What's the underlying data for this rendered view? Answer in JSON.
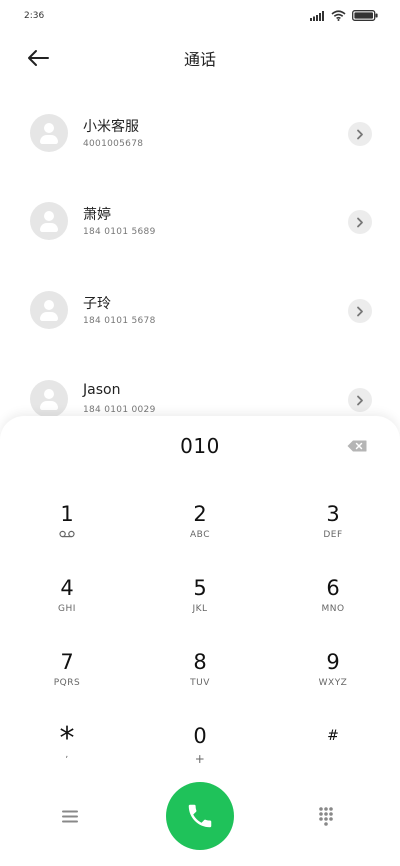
{
  "status_bar": {
    "time": "2:36"
  },
  "header": {
    "title": "通话",
    "back_icon": "arrow-left-icon"
  },
  "contacts": [
    {
      "name": "小米客服",
      "number": "4001005678"
    },
    {
      "name": "萧婷",
      "number": "184 0101 5689"
    },
    {
      "name": "子玲",
      "number": "184 0101 5678"
    },
    {
      "name": "Jason",
      "number": "184 0101 0029"
    }
  ],
  "dialpad": {
    "display": "010",
    "keys": [
      {
        "digit": "1",
        "letters": ""
      },
      {
        "digit": "2",
        "letters": "ABC"
      },
      {
        "digit": "3",
        "letters": "DEF"
      },
      {
        "digit": "4",
        "letters": "GHI"
      },
      {
        "digit": "5",
        "letters": "JKL"
      },
      {
        "digit": "6",
        "letters": "MNO"
      },
      {
        "digit": "7",
        "letters": "PQRS"
      },
      {
        "digit": "8",
        "letters": "TUV"
      },
      {
        "digit": "9",
        "letters": "WXYZ"
      },
      {
        "digit": "*",
        "letters": ","
      },
      {
        "digit": "0",
        "letters": "+"
      },
      {
        "digit": "#",
        "letters": ""
      }
    ]
  },
  "colors": {
    "call_green": "#1fc25a",
    "avatar_bg": "#e6e6e6"
  },
  "icons": {
    "voicemail": "voicemail-icon",
    "backspace": "backspace-icon",
    "menu": "menu-icon",
    "call": "phone-icon",
    "keypad": "keypad-icon"
  }
}
